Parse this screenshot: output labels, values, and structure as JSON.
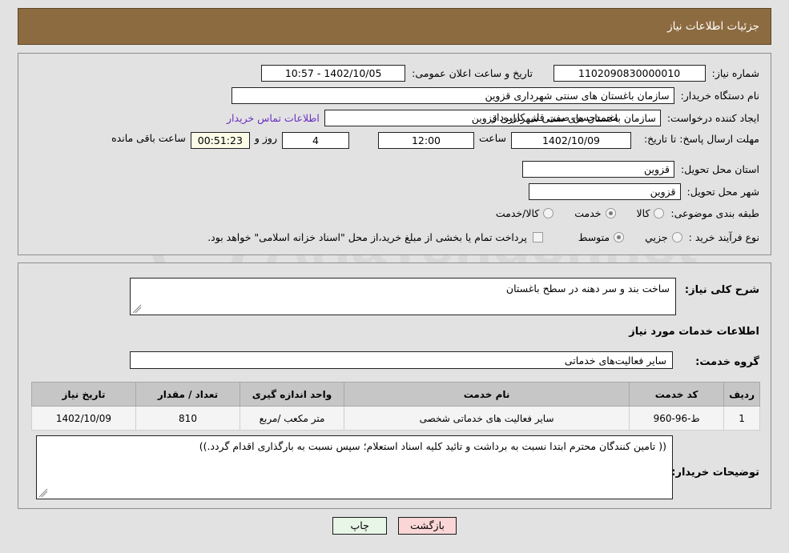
{
  "header": {
    "title": "جزئیات اطلاعات نیاز"
  },
  "form": {
    "need_number_label": "شماره نیاز:",
    "need_number_value": "1102090830000010",
    "announce_label": "تاریخ و ساعت اعلان عمومی:",
    "announce_value": "1402/10/05 - 10:57",
    "buyer_org_label": "نام دستگاه خریدار:",
    "buyer_org_value": "سازمان باغستان های سنتی شهرداری قزوین",
    "creator_label": "ایجاد کننده درخواست:",
    "creator_value": "سازمان باغستان های سنتی شهرداری قزوین",
    "creator_prefix": "محمدحسن صفی قلی کاربرداز",
    "contact_link": "اطلاعات تماس خریدار",
    "deadline_label": "مهلت ارسال پاسخ: تا تاریخ:",
    "deadline_date": "1402/10/09",
    "hour_label": "ساعت",
    "deadline_time": "12:00",
    "days_value": "4",
    "days_label": "روز و",
    "countdown_value": "00:51:23",
    "remaining_label": "ساعت باقی مانده",
    "province_label": "استان محل تحویل:",
    "province_value": "قزوین",
    "city_label": "شهر محل تحویل:",
    "city_value": "قزوین",
    "category_label": "طبقه بندی موضوعی:",
    "category_options": [
      {
        "label": "کالا",
        "selected": false
      },
      {
        "label": "خدمت",
        "selected": true
      },
      {
        "label": "کالا/خدمت",
        "selected": false
      }
    ],
    "purchase_type_label": "نوع فرآیند خرید :",
    "purchase_type_options": [
      {
        "label": "جزیي",
        "selected": false
      },
      {
        "label": "متوسط",
        "selected": true
      }
    ],
    "treasury_checkbox_text": "پرداخت تمام یا بخشی از مبلغ خرید،از محل \"اسناد خزانه اسلامی\" خواهد بود.",
    "treasury_checked": false
  },
  "details": {
    "general_desc_label": "شرح کلی نیاز:",
    "general_desc_value": "ساخت بند و سر دهنه در سطح باغستان",
    "services_section_title": "اطلاعات خدمات مورد نیاز",
    "service_group_label": "گروه خدمت:",
    "service_group_value": "سایر فعالیت‌های خدماتی",
    "notes_label": "توضیحات خریدار:",
    "notes_value": "(( تامین کنندگان محترم ابتدا نسبت به برداشت و تائید کلیه اسناد استعلام؛ سپس نسبت به بارگذاری اقدام گردد.))"
  },
  "table": {
    "columns": [
      "ردیف",
      "کد خدمت",
      "نام خدمت",
      "واحد اندازه گیری",
      "تعداد / مقدار",
      "تاریخ نیاز"
    ],
    "rows": [
      {
        "index": "1",
        "code": "ط-96-960",
        "name": "سایر فعالیت های خدماتی شخصی",
        "unit": "متر مکعب /مربع",
        "quantity": "810",
        "date": "1402/10/09"
      }
    ]
  },
  "footer": {
    "print_label": "چاپ",
    "back_label": "بازگشت"
  },
  "watermark": {
    "text": "AriaTender.net"
  },
  "colors": {
    "header_brown": "#8d6b40",
    "page_bg": "#e2e2e2",
    "link_purple": "#6a2fbf",
    "countdown_bg": "#fbfbe8",
    "back_button_bg": "#fad6d6",
    "print_button_bg": "#e8f6e8"
  }
}
